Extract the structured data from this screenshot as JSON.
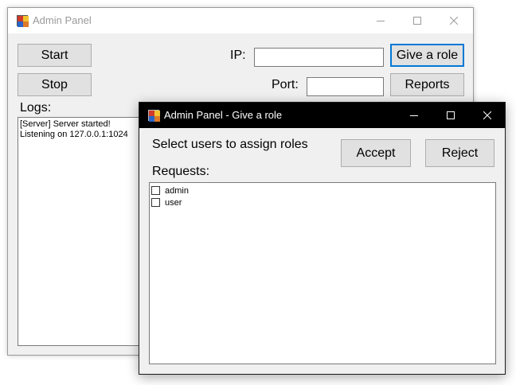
{
  "main_window": {
    "title": "Admin Panel",
    "start_label": "Start",
    "stop_label": "Stop",
    "ip_label": "IP:",
    "ip_value": "",
    "port_label": "Port:",
    "port_value": "",
    "give_role_label": "Give a role",
    "reports_label": "Reports",
    "logs_label": "Logs:",
    "log_lines": [
      "[Server] Server started!",
      "Listening on 127.0.0.1:1024"
    ]
  },
  "dialog": {
    "title": "Admin Panel - Give a role",
    "instruction": "Select users to assign roles",
    "accept_label": "Accept",
    "reject_label": "Reject",
    "requests_label": "Requests:",
    "requests": [
      {
        "label": "admin",
        "checked": false
      },
      {
        "label": "user",
        "checked": false
      }
    ]
  },
  "icons": {
    "app": "app-icon",
    "minimize": "minimize-icon",
    "maximize": "maximize-icon",
    "close": "close-icon"
  },
  "colors": {
    "focus_border": "#0078d7",
    "dialog_titlebar": "#000000",
    "window_background": "#f0f0f0"
  }
}
